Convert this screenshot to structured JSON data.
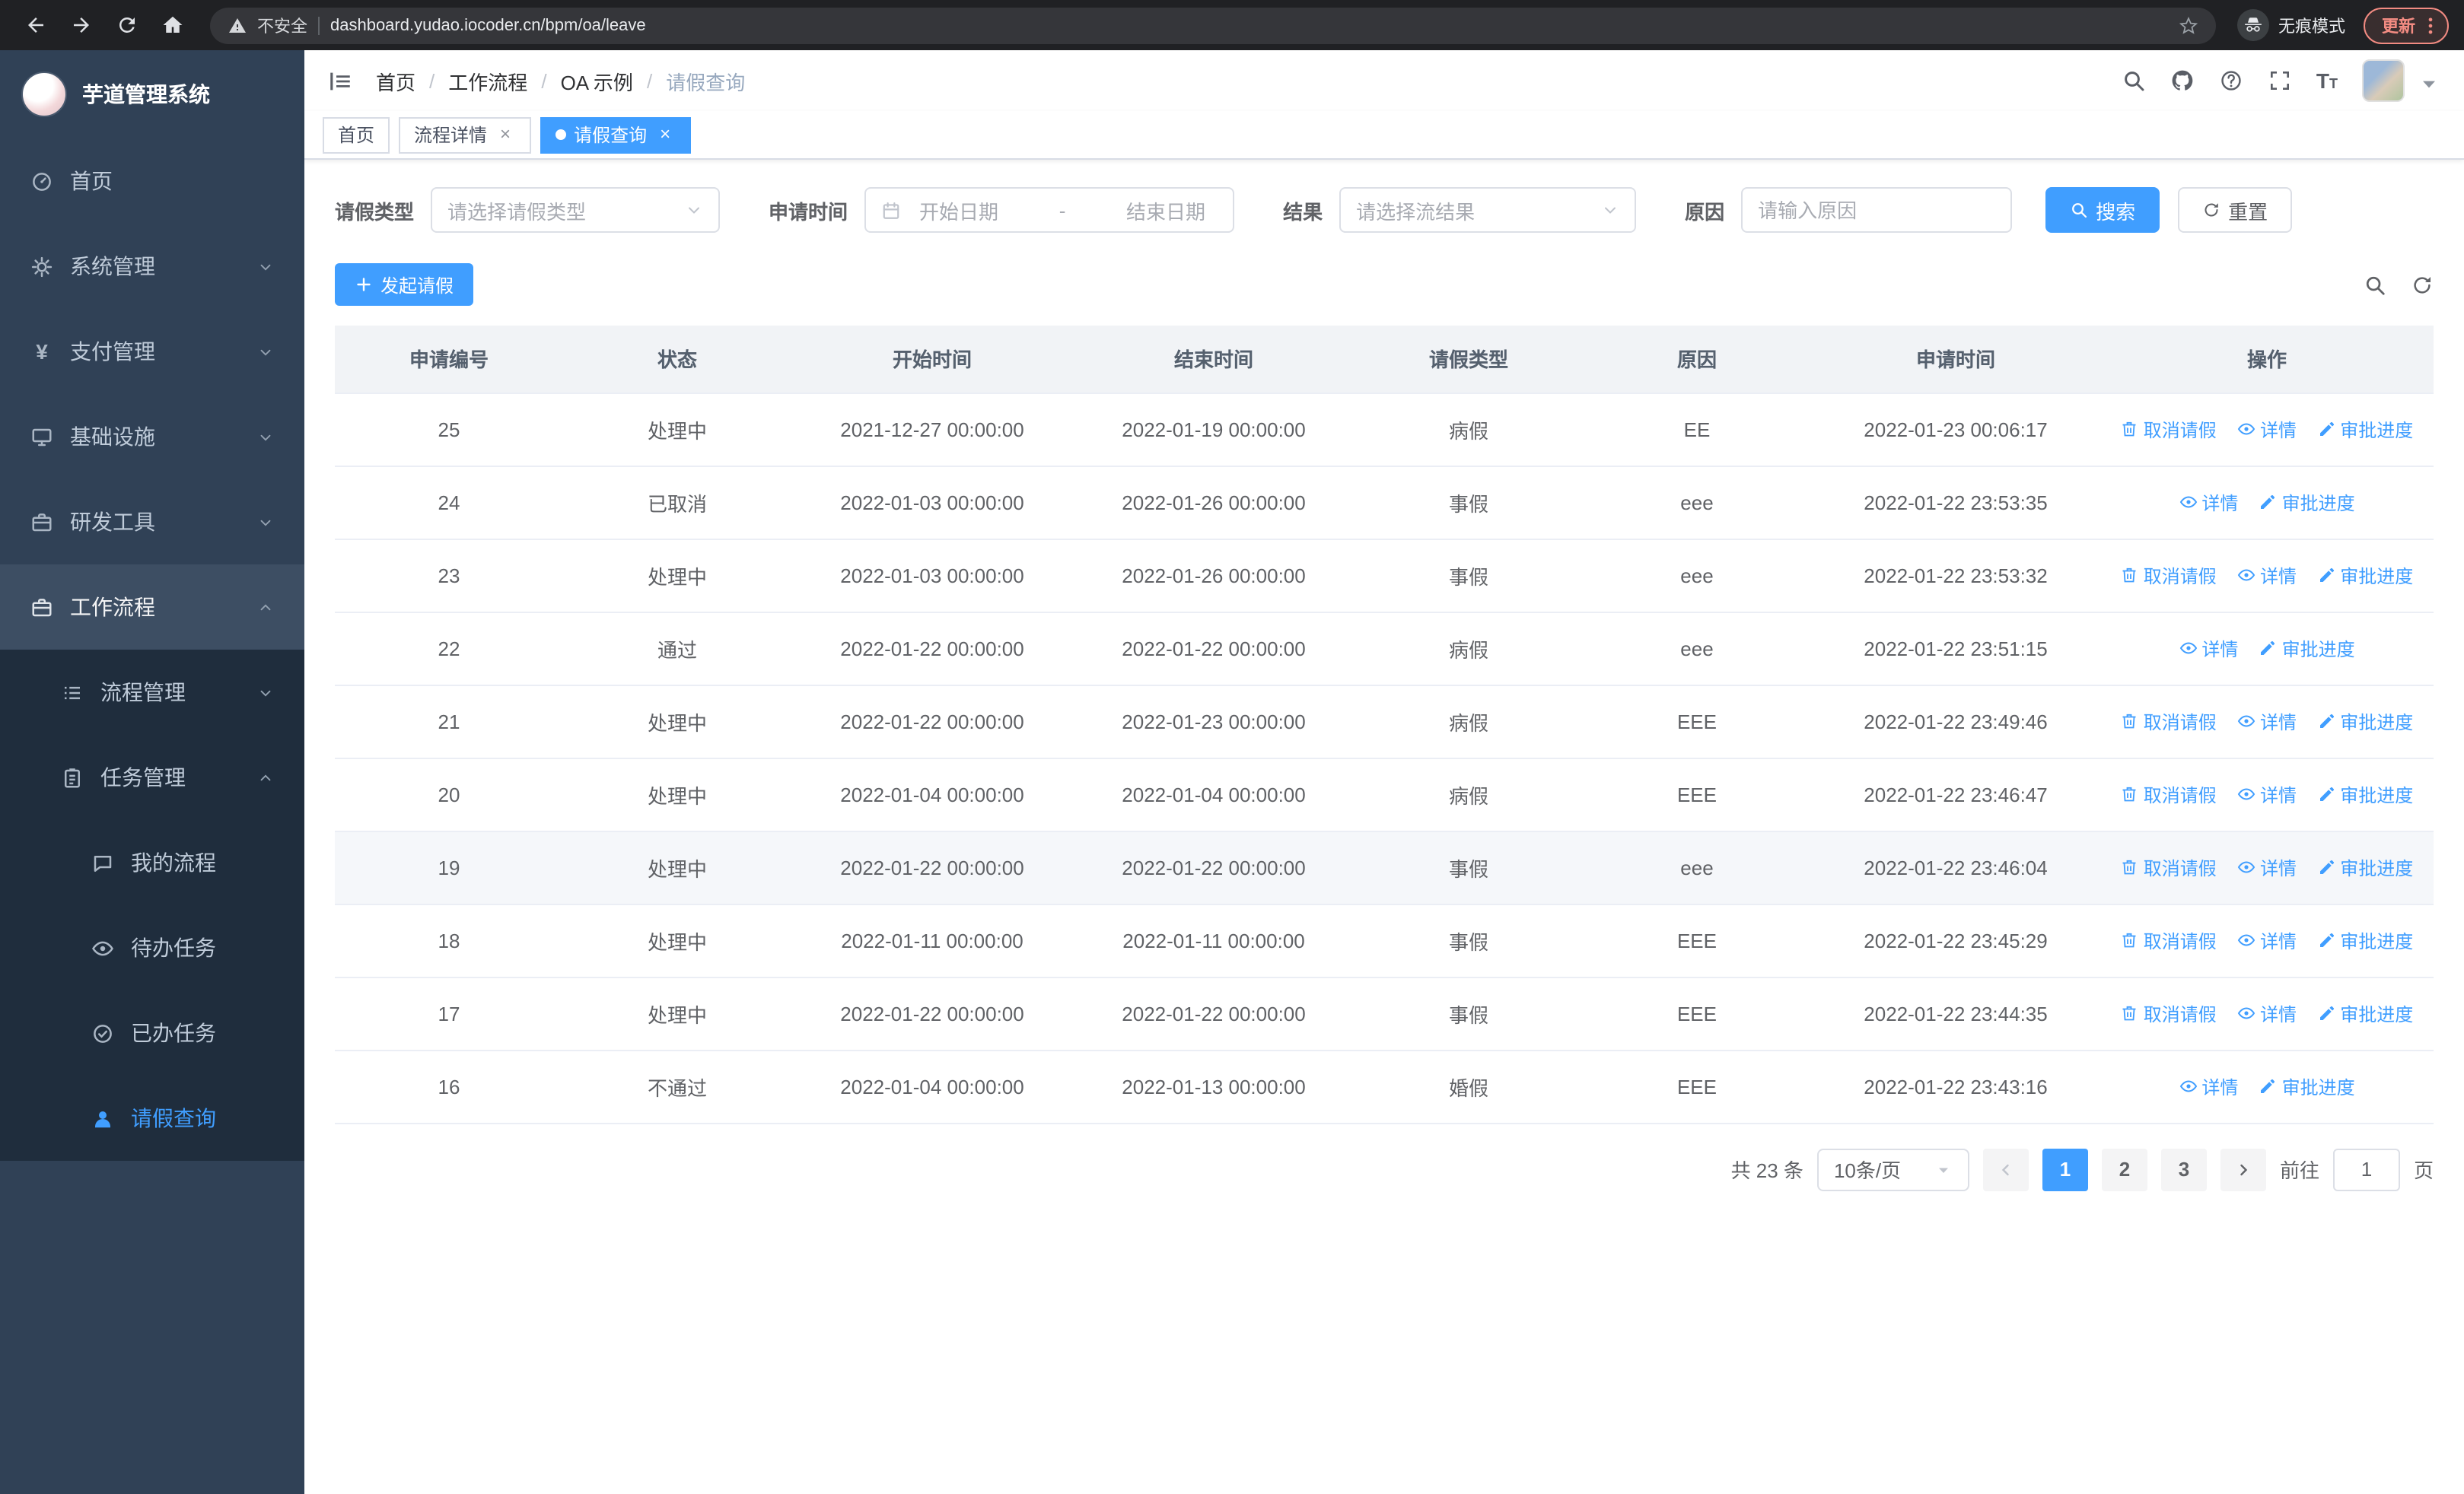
{
  "browser": {
    "security_label": "不安全",
    "url": "dashboard.yudao.iocoder.cn/bpm/oa/leave",
    "incognito_label": "无痕模式",
    "update_label": "更新"
  },
  "sidebar": {
    "title": "芋道管理系统",
    "items": [
      {
        "label": "首页",
        "icon": "dashboard-icon",
        "level": 0
      },
      {
        "label": "系统管理",
        "icon": "gear-icon",
        "level": 0,
        "state": "collapsed"
      },
      {
        "label": "支付管理",
        "icon": "yen-icon",
        "glyph": "¥",
        "level": 0,
        "state": "collapsed"
      },
      {
        "label": "基础设施",
        "icon": "monitor-icon",
        "level": 0,
        "state": "collapsed"
      },
      {
        "label": "研发工具",
        "icon": "briefcase-icon",
        "level": 0,
        "state": "collapsed"
      },
      {
        "label": "工作流程",
        "icon": "workflow-icon",
        "level": 0,
        "state": "expanded"
      },
      {
        "label": "流程管理",
        "icon": "list-icon",
        "level": 1,
        "state": "collapsed"
      },
      {
        "label": "任务管理",
        "icon": "clipboard-icon",
        "level": 1,
        "state": "expanded"
      },
      {
        "label": "我的流程",
        "icon": "chat-icon",
        "level": 2
      },
      {
        "label": "待办任务",
        "icon": "eye-icon",
        "level": 2
      },
      {
        "label": "已办任务",
        "icon": "done-icon",
        "level": 2
      },
      {
        "label": "请假查询",
        "icon": "user-icon",
        "level": 2,
        "active": true
      }
    ]
  },
  "header": {
    "breadcrumb": [
      "首页",
      "工作流程",
      "OA 示例",
      "请假查询"
    ],
    "separator": "/",
    "font_icon_glyph": "T"
  },
  "tabs": {
    "close_glyph": "×",
    "items": [
      {
        "label": "首页",
        "closable": false,
        "active": false
      },
      {
        "label": "流程详情",
        "closable": true,
        "active": false
      },
      {
        "label": "请假查询",
        "closable": true,
        "active": true
      }
    ]
  },
  "filters": {
    "leave_type_label": "请假类型",
    "leave_type_placeholder": "请选择请假类型",
    "apply_time_label": "申请时间",
    "start_date_placeholder": "开始日期",
    "range_separator": "-",
    "end_date_placeholder": "结束日期",
    "result_label": "结果",
    "result_placeholder": "请选择流结果",
    "reason_label": "原因",
    "reason_placeholder": "请输入原因",
    "search_button": "搜索",
    "reset_button": "重置"
  },
  "toolbar": {
    "create_button": "发起请假"
  },
  "table": {
    "columns": [
      "申请编号",
      "状态",
      "开始时间",
      "结束时间",
      "请假类型",
      "原因",
      "申请时间",
      "操作"
    ],
    "actions": {
      "cancel": "取消请假",
      "detail": "详情",
      "progress": "审批进度"
    },
    "rows": [
      {
        "id": "25",
        "status": "处理中",
        "start": "2021-12-27 00:00:00",
        "end": "2022-01-19 00:00:00",
        "type": "病假",
        "reason": "EE",
        "applied": "2022-01-23 00:06:17",
        "cancelable": true,
        "hover": false
      },
      {
        "id": "24",
        "status": "已取消",
        "start": "2022-01-03 00:00:00",
        "end": "2022-01-26 00:00:00",
        "type": "事假",
        "reason": "eee",
        "applied": "2022-01-22 23:53:35",
        "cancelable": false,
        "hover": false
      },
      {
        "id": "23",
        "status": "处理中",
        "start": "2022-01-03 00:00:00",
        "end": "2022-01-26 00:00:00",
        "type": "事假",
        "reason": "eee",
        "applied": "2022-01-22 23:53:32",
        "cancelable": true,
        "hover": false
      },
      {
        "id": "22",
        "status": "通过",
        "start": "2022-01-22 00:00:00",
        "end": "2022-01-22 00:00:00",
        "type": "病假",
        "reason": "eee",
        "applied": "2022-01-22 23:51:15",
        "cancelable": false,
        "hover": false
      },
      {
        "id": "21",
        "status": "处理中",
        "start": "2022-01-22 00:00:00",
        "end": "2022-01-23 00:00:00",
        "type": "病假",
        "reason": "EEE",
        "applied": "2022-01-22 23:49:46",
        "cancelable": true,
        "hover": false
      },
      {
        "id": "20",
        "status": "处理中",
        "start": "2022-01-04 00:00:00",
        "end": "2022-01-04 00:00:00",
        "type": "病假",
        "reason": "EEE",
        "applied": "2022-01-22 23:46:47",
        "cancelable": true,
        "hover": false
      },
      {
        "id": "19",
        "status": "处理中",
        "start": "2022-01-22 00:00:00",
        "end": "2022-01-22 00:00:00",
        "type": "事假",
        "reason": "eee",
        "applied": "2022-01-22 23:46:04",
        "cancelable": true,
        "hover": true
      },
      {
        "id": "18",
        "status": "处理中",
        "start": "2022-01-11 00:00:00",
        "end": "2022-01-11 00:00:00",
        "type": "事假",
        "reason": "EEE",
        "applied": "2022-01-22 23:45:29",
        "cancelable": true,
        "hover": false
      },
      {
        "id": "17",
        "status": "处理中",
        "start": "2022-01-22 00:00:00",
        "end": "2022-01-22 00:00:00",
        "type": "事假",
        "reason": "EEE",
        "applied": "2022-01-22 23:44:35",
        "cancelable": true,
        "hover": false
      },
      {
        "id": "16",
        "status": "不通过",
        "start": "2022-01-04 00:00:00",
        "end": "2022-01-13 00:00:00",
        "type": "婚假",
        "reason": "EEE",
        "applied": "2022-01-22 23:43:16",
        "cancelable": false,
        "hover": false
      }
    ]
  },
  "pagination": {
    "total_text": "共 23 条",
    "page_size": "10条/页",
    "pages": [
      "1",
      "2",
      "3"
    ],
    "active_page": "1",
    "goto_label": "前往",
    "goto_value": "1",
    "goto_suffix": "页"
  }
}
